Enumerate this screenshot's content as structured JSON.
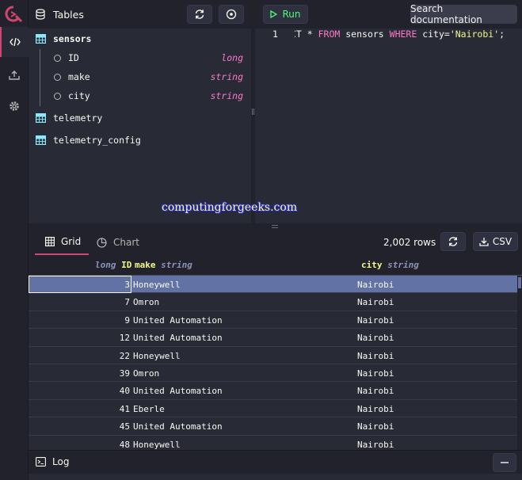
{
  "sidebar": {
    "nav": [
      "code-editor",
      "import",
      "settings"
    ]
  },
  "tables_panel": {
    "title": "Tables",
    "tables": [
      {
        "name": "sensors",
        "expanded": true,
        "columns": [
          {
            "name": "ID",
            "type": "long"
          },
          {
            "name": "make",
            "type": "string"
          },
          {
            "name": "city",
            "type": "string"
          }
        ]
      },
      {
        "name": "telemetry"
      },
      {
        "name": "telemetry_config"
      }
    ]
  },
  "editor": {
    "run_label": "Run",
    "search_placeholder": "Search documentation",
    "line_number": "1",
    "query": {
      "part1": "CT * ",
      "kw_from": "FROM",
      "part2": " sensors ",
      "kw_where": "WHERE",
      "part3": " city=",
      "literal": "'Nairobi'",
      "part4": ";"
    }
  },
  "watermark": "computingforgeeks.com",
  "results": {
    "tabs": [
      {
        "label": "Grid",
        "active": true
      },
      {
        "label": "Chart",
        "active": false
      }
    ],
    "row_count": "2,002 rows",
    "csv_label": "CSV",
    "columns": [
      {
        "type": "long",
        "name": "ID"
      },
      {
        "name": "make",
        "type": "string"
      },
      {
        "name": "city",
        "type": "string"
      }
    ],
    "rows": [
      {
        "id": "3",
        "make": "Honeywell",
        "city": "Nairobi"
      },
      {
        "id": "7",
        "make": "Omron",
        "city": "Nairobi"
      },
      {
        "id": "9",
        "make": "United Automation",
        "city": "Nairobi"
      },
      {
        "id": "12",
        "make": "United Automation",
        "city": "Nairobi"
      },
      {
        "id": "22",
        "make": "Honeywell",
        "city": "Nairobi"
      },
      {
        "id": "39",
        "make": "Omron",
        "city": "Nairobi"
      },
      {
        "id": "40",
        "make": "United Automation",
        "city": "Nairobi"
      },
      {
        "id": "41",
        "make": "Eberle",
        "city": "Nairobi"
      },
      {
        "id": "45",
        "make": "United Automation",
        "city": "Nairobi"
      },
      {
        "id": "48",
        "make": "Honeywell",
        "city": "Nairobi"
      }
    ]
  },
  "log": {
    "label": "Log"
  },
  "colors": {
    "accent": "#d14671",
    "keyword": "#ff79c6",
    "string_literal": "#f1fa8c",
    "run_green": "#50fa7b",
    "selection": "#6272a4"
  }
}
